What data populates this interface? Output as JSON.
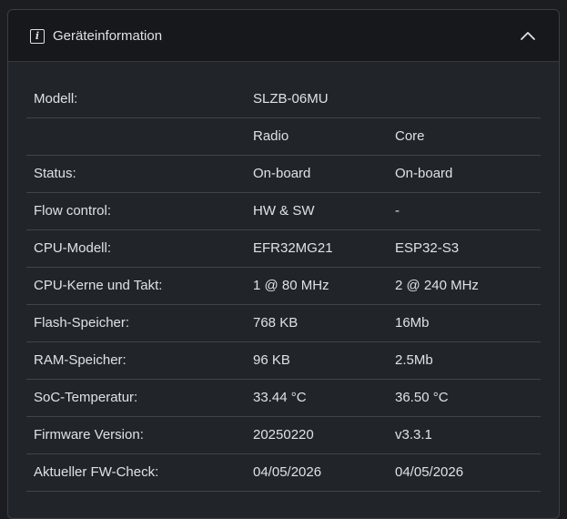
{
  "header": {
    "title": "Geräteinformation",
    "info_icon_glyph": "i",
    "collapse_icon": "chevron-up-icon"
  },
  "table": {
    "columns": [
      "",
      "Radio",
      "Core"
    ],
    "model": {
      "label": "Modell:",
      "value": "SLZB-06MU"
    },
    "rows": [
      {
        "label": "Status:",
        "radio": "On-board",
        "core": "On-board"
      },
      {
        "label": "Flow control:",
        "radio": "HW & SW",
        "core": "-"
      },
      {
        "label": "CPU-Modell:",
        "radio": "EFR32MG21",
        "core": "ESP32-S3"
      },
      {
        "label": "CPU-Kerne und Takt:",
        "radio": "1 @ 80 MHz",
        "core": "2 @ 240 MHz"
      },
      {
        "label": "Flash-Speicher:",
        "radio": "768 KB",
        "core": "16Mb"
      },
      {
        "label": "RAM-Speicher:",
        "radio": "96 KB",
        "core": "2.5Mb"
      },
      {
        "label": "SoC-Temperatur:",
        "radio": "33.44 °C",
        "core": "36.50 °C"
      },
      {
        "label": "Firmware Version:",
        "radio": "20250220",
        "core": "v3.3.1"
      },
      {
        "label": "Aktueller FW-Check:",
        "radio": "04/05/2026",
        "core": "04/05/2026"
      }
    ]
  },
  "colors": {
    "background": "#1b1d20",
    "card": "#212529",
    "header": "#16181b",
    "text": "#dee2e6",
    "divider": "#3f444a"
  }
}
